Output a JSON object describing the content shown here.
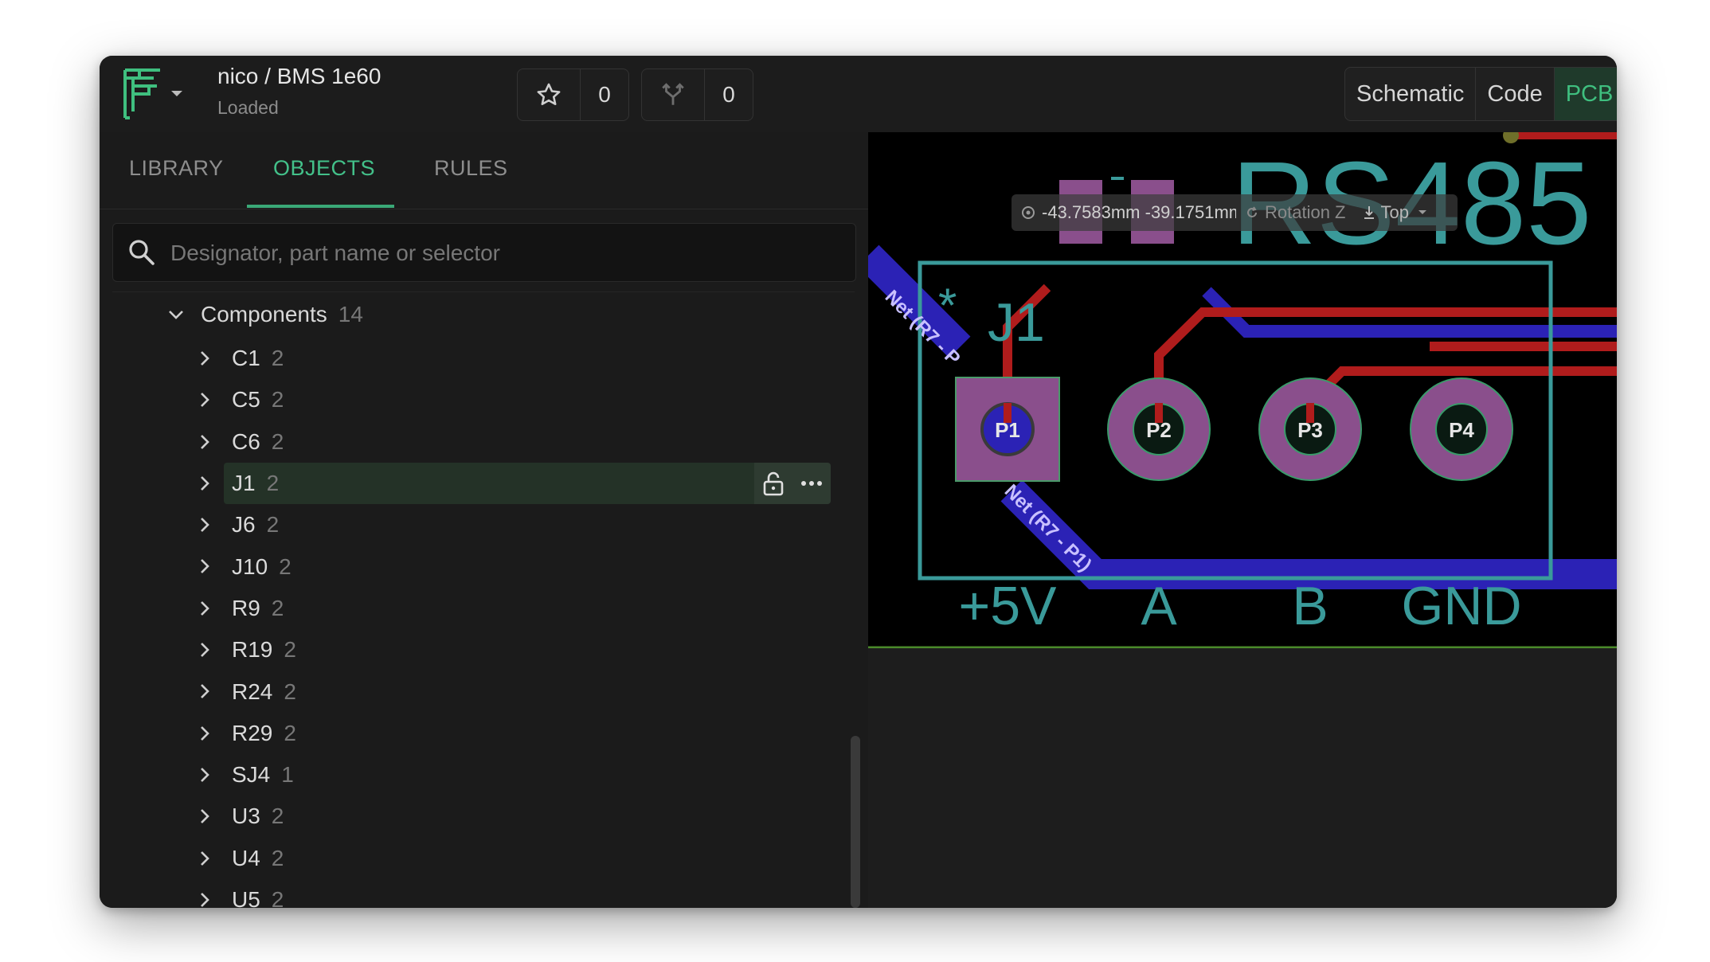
{
  "header": {
    "project_title": "nico / BMS 1e60",
    "status": "Loaded",
    "star_count": "0",
    "fork_count": "0",
    "views": [
      {
        "label": "Schematic",
        "active": false
      },
      {
        "label": "Code",
        "active": false
      },
      {
        "label": "PCB",
        "active": true
      }
    ]
  },
  "sidebar": {
    "tabs": [
      {
        "label": "LIBRARY",
        "active": false
      },
      {
        "label": "OBJECTS",
        "active": true
      },
      {
        "label": "RULES",
        "active": false
      }
    ],
    "search": {
      "placeholder": "Designator, part name or selector",
      "value": ""
    },
    "tree": {
      "group_label": "Components",
      "group_count": "14",
      "items": [
        {
          "label": "C1",
          "count": "2"
        },
        {
          "label": "C5",
          "count": "2"
        },
        {
          "label": "C6",
          "count": "2"
        },
        {
          "label": "J1",
          "count": "2",
          "selected": true
        },
        {
          "label": "J6",
          "count": "2"
        },
        {
          "label": "J10",
          "count": "2"
        },
        {
          "label": "R9",
          "count": "2"
        },
        {
          "label": "R19",
          "count": "2"
        },
        {
          "label": "R24",
          "count": "2"
        },
        {
          "label": "R29",
          "count": "2"
        },
        {
          "label": "SJ4",
          "count": "1"
        },
        {
          "label": "U3",
          "count": "2"
        },
        {
          "label": "U4",
          "count": "2"
        },
        {
          "label": "U5",
          "count": "2"
        }
      ]
    }
  },
  "canvas": {
    "toolbar": {
      "coords": "-43.7583mm -39.1751mm",
      "rotation_label": "Rotation Z",
      "layer": "Top"
    },
    "board_text": "RS485",
    "component_designator": "J1",
    "pin1_marker": "*",
    "pads": [
      "P1",
      "P2",
      "P3",
      "P4"
    ],
    "pin_labels": [
      "+5V",
      "A",
      "B",
      "GND"
    ],
    "net_label": "Net (R7 - P1)",
    "net_label_partial": "Net (R7 - P",
    "colors": {
      "accent": "#3fbf7f",
      "silkscreen": "#3a9a9a",
      "copper_top": "#b01c1c",
      "copper_bottom": "#2b22b5",
      "pad": "#8a4f8c",
      "board_edge": "#4a8a2a"
    }
  }
}
